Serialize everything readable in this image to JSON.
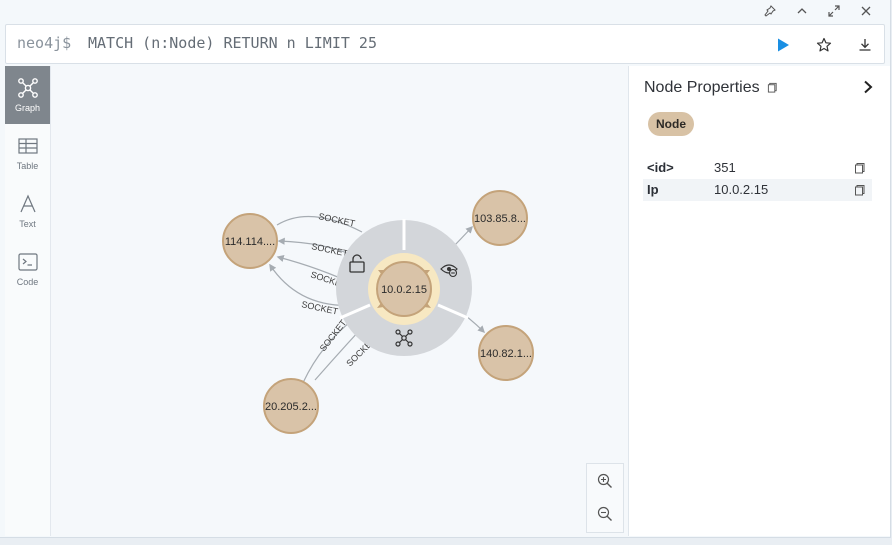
{
  "editor": {
    "prompt": "neo4j$",
    "query": "MATCH (n:Node) RETURN n LIMIT 25"
  },
  "sidebar": {
    "items": [
      {
        "label": "Graph",
        "icon": "graph-icon",
        "active": true
      },
      {
        "label": "Table",
        "icon": "table-icon",
        "active": false
      },
      {
        "label": "Text",
        "icon": "text-icon",
        "active": false
      },
      {
        "label": "Code",
        "icon": "code-icon",
        "active": false
      }
    ]
  },
  "graph": {
    "center_node": "10.0.2.15",
    "nodes": [
      {
        "id": "n1",
        "label": "114.114...."
      },
      {
        "id": "n2",
        "label": "103.85.8..."
      },
      {
        "id": "n3",
        "label": "140.82.1..."
      },
      {
        "id": "n4",
        "label": "20.205.2..."
      }
    ],
    "relationship_type": "SOCKET",
    "node_color": "#d9c3a8",
    "node_border": "#c4a37a",
    "ring_color": "#d3d6da",
    "highlight_color": "#f7e8c2"
  },
  "panel": {
    "title": "Node Properties",
    "label_chip": "Node",
    "properties": [
      {
        "key": "<id>",
        "value": "351"
      },
      {
        "key": "Ip",
        "value": "10.0.2.15"
      }
    ]
  },
  "colors": {
    "accent": "#1a8fe3",
    "active_sidebar": "#7f868d"
  }
}
